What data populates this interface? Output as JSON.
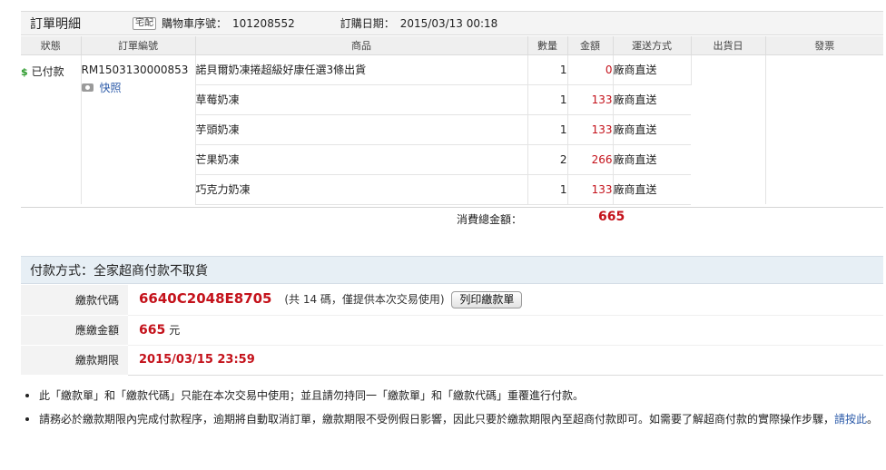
{
  "order_header": {
    "title": "訂單明細",
    "delivery_tag": "宅配",
    "cart_label": "購物車序號：",
    "cart_no": "101208552",
    "date_label": "訂購日期：",
    "date": "2015/03/13 00:18"
  },
  "table": {
    "columns": [
      "狀態",
      "訂單編號",
      "商品",
      "數量",
      "金額",
      "運送方式",
      "出貨日",
      "發票"
    ],
    "status_icon": "$",
    "status": "已付款",
    "order_no": "RM1503130000853",
    "snapshot_link": "快照",
    "items": [
      {
        "product": "諾貝爾奶凍捲超級好康任選3條出貨",
        "qty": "1",
        "amount": "0",
        "ship": "廠商直送"
      },
      {
        "product": "草莓奶凍",
        "qty": "1",
        "amount": "133",
        "ship": "廠商直送"
      },
      {
        "product": "芋頭奶凍",
        "qty": "1",
        "amount": "133",
        "ship": "廠商直送"
      },
      {
        "product": "芒果奶凍",
        "qty": "2",
        "amount": "266",
        "ship": "廠商直送"
      },
      {
        "product": "巧克力奶凍",
        "qty": "1",
        "amount": "133",
        "ship": "廠商直送"
      }
    ]
  },
  "total": {
    "label": "消費總金額：",
    "value": "665"
  },
  "payment": {
    "title": "付款方式：全家超商付款不取貨",
    "code_label": "繳款代碼",
    "code": "6640C2048E8705",
    "code_note": "(共 14 碼，僅提供本次交易使用)",
    "print_button": "列印繳款單",
    "amount_label": "應繳金額",
    "amount": "665",
    "amount_unit": "元",
    "deadline_label": "繳款期限",
    "deadline": "2015/03/15 23:59"
  },
  "notes": {
    "note1": "此「繳款單」和「繳款代碼」只能在本次交易中使用；並且請勿持同一「繳款單」和「繳款代碼」重覆進行付款。",
    "note2_text": "請務必於繳款期限內完成付款程序，逾期將自動取消訂單，繳款期限不受例假日影響，因此只要於繳款期限內至超商付款即可。如需要了解超商付款的實際操作步驟，",
    "note2_link": "請按此",
    "note2_end": "。"
  },
  "colors": {
    "accent_red": "#c4121b",
    "link_blue": "#2a59a8",
    "paid_green": "#2b9a2b"
  }
}
